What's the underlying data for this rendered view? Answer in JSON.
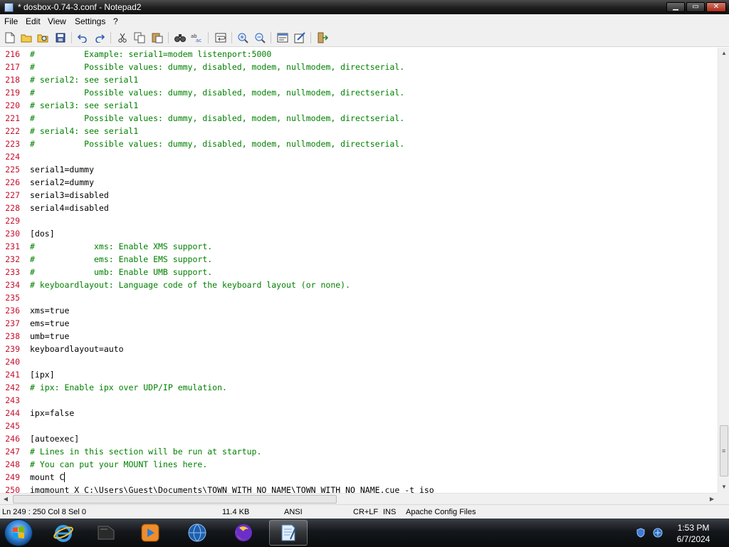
{
  "window": {
    "title": "* dosbox-0.74-3.conf - Notepad2",
    "minimize": "▁",
    "maximize": "▭",
    "close": "✕"
  },
  "menu": {
    "items": [
      "File",
      "Edit",
      "View",
      "Settings",
      "?"
    ]
  },
  "toolbar": {
    "icons": [
      "new-file-icon",
      "open-folder-icon",
      "browse-icon",
      "save-icon",
      "undo-icon",
      "redo-icon",
      "cut-icon",
      "copy-icon",
      "paste-icon",
      "find-icon",
      "replace-icon",
      "word-wrap-icon",
      "zoom-in-icon",
      "zoom-out-icon",
      "scheme-icon",
      "customize-icon",
      "exit-icon"
    ]
  },
  "editor": {
    "lines": [
      {
        "num": "216",
        "text": "#          Example: serial1=modem listenport:5000",
        "comment": true
      },
      {
        "num": "217",
        "text": "#          Possible values: dummy, disabled, modem, nullmodem, directserial.",
        "comment": true
      },
      {
        "num": "218",
        "text": "# serial2: see serial1",
        "comment": true
      },
      {
        "num": "219",
        "text": "#          Possible values: dummy, disabled, modem, nullmodem, directserial.",
        "comment": true
      },
      {
        "num": "220",
        "text": "# serial3: see serial1",
        "comment": true
      },
      {
        "num": "221",
        "text": "#          Possible values: dummy, disabled, modem, nullmodem, directserial.",
        "comment": true
      },
      {
        "num": "222",
        "text": "# serial4: see serial1",
        "comment": true
      },
      {
        "num": "223",
        "text": "#          Possible values: dummy, disabled, modem, nullmodem, directserial.",
        "comment": true
      },
      {
        "num": "224",
        "text": "",
        "comment": false
      },
      {
        "num": "225",
        "text": "serial1=dummy",
        "comment": false
      },
      {
        "num": "226",
        "text": "serial2=dummy",
        "comment": false
      },
      {
        "num": "227",
        "text": "serial3=disabled",
        "comment": false
      },
      {
        "num": "228",
        "text": "serial4=disabled",
        "comment": false
      },
      {
        "num": "229",
        "text": "",
        "comment": false
      },
      {
        "num": "230",
        "text": "[dos]",
        "comment": false
      },
      {
        "num": "231",
        "text": "#            xms: Enable XMS support.",
        "comment": true
      },
      {
        "num": "232",
        "text": "#            ems: Enable EMS support.",
        "comment": true
      },
      {
        "num": "233",
        "text": "#            umb: Enable UMB support.",
        "comment": true
      },
      {
        "num": "234",
        "text": "# keyboardlayout: Language code of the keyboard layout (or none).",
        "comment": true
      },
      {
        "num": "235",
        "text": "",
        "comment": false
      },
      {
        "num": "236",
        "text": "xms=true",
        "comment": false
      },
      {
        "num": "237",
        "text": "ems=true",
        "comment": false
      },
      {
        "num": "238",
        "text": "umb=true",
        "comment": false
      },
      {
        "num": "239",
        "text": "keyboardlayout=auto",
        "comment": false
      },
      {
        "num": "240",
        "text": "",
        "comment": false
      },
      {
        "num": "241",
        "text": "[ipx]",
        "comment": false
      },
      {
        "num": "242",
        "text": "# ipx: Enable ipx over UDP/IP emulation.",
        "comment": true
      },
      {
        "num": "243",
        "text": "",
        "comment": false
      },
      {
        "num": "244",
        "text": "ipx=false",
        "comment": false
      },
      {
        "num": "245",
        "text": "",
        "comment": false
      },
      {
        "num": "246",
        "text": "[autoexec]",
        "comment": false
      },
      {
        "num": "247",
        "text": "# Lines in this section will be run at startup.",
        "comment": true
      },
      {
        "num": "248",
        "text": "# You can put your MOUNT lines here.",
        "comment": true
      },
      {
        "num": "249",
        "text": "mount C",
        "comment": false
      },
      {
        "num": "250",
        "text": "imgmount X C:\\Users\\Guest\\Documents\\TOWN WITH NO NAME\\TOWN WITH NO NAME.cue -t iso",
        "comment": false
      }
    ]
  },
  "statusbar": {
    "position": "Ln 249 : 250  Col 8  Sel 0",
    "size": "11.4 KB",
    "encoding": "ANSI",
    "line_endings": "CR+LF",
    "mode": "INS",
    "scheme": "Apache Config Files"
  },
  "taskbar": {
    "apps": [
      "internet-explorer-icon",
      "media-center-icon",
      "media-player-icon",
      "globe-icon",
      "firefox-icon",
      "notepad2-icon"
    ],
    "tray": [
      "shield-icon",
      "network-icon"
    ],
    "time": "1:53 PM",
    "date": "6/7/2024"
  }
}
